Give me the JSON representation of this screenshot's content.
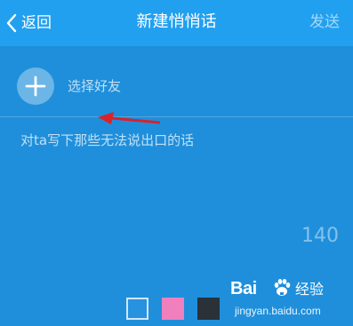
{
  "header": {
    "back_label": "返回",
    "title": "新建悄悄话",
    "send_label": "发送"
  },
  "friend": {
    "label": "选择好友"
  },
  "message": {
    "placeholder": "对ta写下那些无法说出口的话"
  },
  "counter": "140",
  "colors": {
    "options": [
      {
        "name": "blue",
        "hex": "#2792df"
      },
      {
        "name": "pink",
        "hex": "#f080bd"
      },
      {
        "name": "dark",
        "hex": "#2a3138"
      }
    ]
  },
  "watermark": {
    "brand": "Bai",
    "suffix": "经验",
    "domain": "jingyan.baidu.com"
  },
  "icons": [
    "back-arrow-icon",
    "plus-icon",
    "red-arrow-icon",
    "baidu-paw-icon"
  ]
}
